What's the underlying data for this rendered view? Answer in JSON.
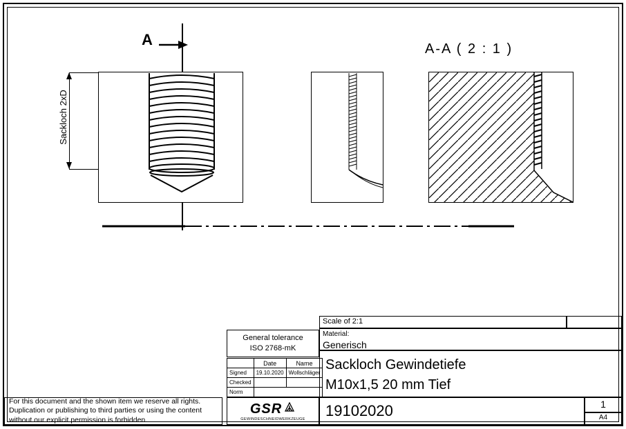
{
  "drawing": {
    "section_marker": "A",
    "section_view_label": "A-A  ( 2 : 1 )",
    "dimension_label": "Sackloch 2xD"
  },
  "titleblock": {
    "tolerance_heading": "General tolerance",
    "tolerance_std": "ISO 2768-mK",
    "col_date": "Date",
    "col_name": "Name",
    "row_signed": "Signed",
    "row_checked": "Checked",
    "row_norm": "Norm",
    "signed_date": "19.10.2020",
    "signed_name": "Wollschläger",
    "scale_label": "Scale of 2:1",
    "material_label": "Material:",
    "material_value": "Generisch",
    "title_line1": "Sackloch Gewindetiefe",
    "title_line2": "M10x1,5     20 mm Tief",
    "drawing_number": "19102020",
    "sheet": "1",
    "format": "A4",
    "logo_text": "GSR",
    "logo_sub": "GEWINDESCHNEIDWERKZEUGE"
  },
  "copyright": "For this document and the shown item we reserve all rights. Duplication or publishing to third parties or using the content without our explicit permission is forbidden."
}
